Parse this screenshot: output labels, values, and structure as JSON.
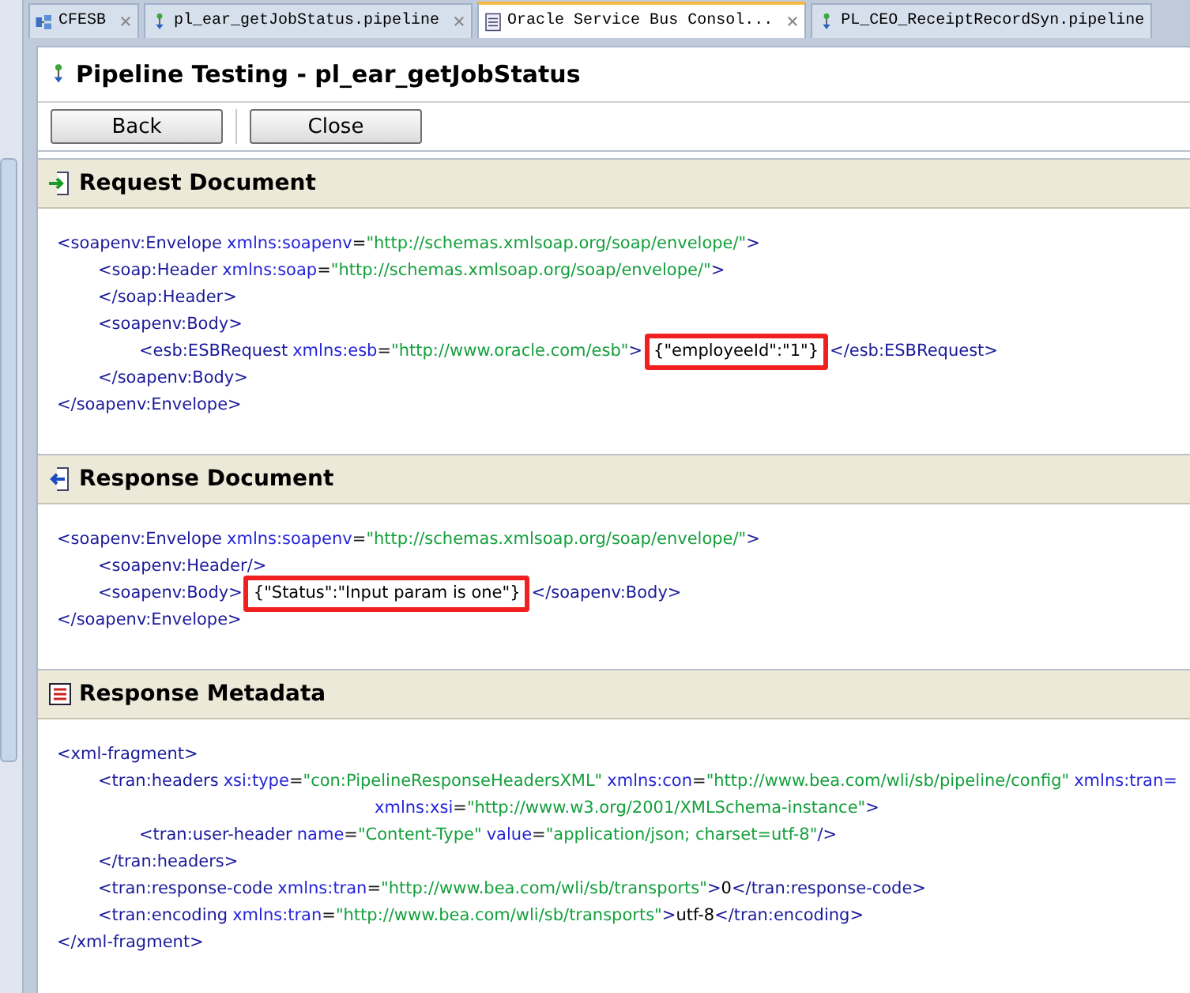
{
  "tabs": [
    {
      "label": "CFESB",
      "selected": false,
      "closable": true
    },
    {
      "label": "pl_ear_getJobStatus.pipeline",
      "selected": false,
      "closable": true
    },
    {
      "label": "Oracle Service Bus Consol...",
      "selected": true,
      "closable": true
    },
    {
      "label": "PL_CEO_ReceiptRecordSyn.pipeline",
      "selected": false,
      "closable": false
    }
  ],
  "page": {
    "title": "Pipeline Testing - pl_ear_getJobStatus",
    "buttons": [
      "Back",
      "Close"
    ]
  },
  "sections": [
    {
      "title": "Request Document",
      "nodes": [
        {
          "tokens": [
            {
              "kind": "tag",
              "text": "<soapenv:Envelope"
            },
            {
              "kind": "attr",
              "text": "xmlns:soapenv"
            },
            {
              "kind": "punct",
              "text": "="
            },
            {
              "kind": "val",
              "text": "\"http://schemas.xmlsoap.org/soap/envelope/\""
            },
            {
              "kind": "tag",
              "text": ">"
            }
          ],
          "children": [
            {
              "tokens": [
                {
                  "kind": "tag",
                  "text": "<soap:Header"
                },
                {
                  "kind": "attr",
                  "text": "xmlns:soap"
                },
                {
                  "kind": "punct",
                  "text": "="
                },
                {
                  "kind": "val",
                  "text": "\"http://schemas.xmlsoap.org/soap/envelope/\""
                },
                {
                  "kind": "tag",
                  "text": ">"
                }
              ]
            },
            {
              "tokens": [
                {
                  "kind": "tag",
                  "text": "</soap:Header>"
                }
              ]
            },
            {
              "tokens": [
                {
                  "kind": "tag",
                  "text": "<soapenv:Body>"
                }
              ],
              "children": [
                {
                  "tokens": [
                    {
                      "kind": "tag",
                      "text": "<esb:ESBRequest"
                    },
                    {
                      "kind": "attr",
                      "text": "xmlns:esb"
                    },
                    {
                      "kind": "punct",
                      "text": "="
                    },
                    {
                      "kind": "val",
                      "text": "\"http://www.oracle.com/esb\""
                    },
                    {
                      "kind": "tag",
                      "text": ">"
                    },
                    {
                      "kind": "text",
                      "text": "{\"employeeId\":\"1\"}",
                      "highlight": true
                    },
                    {
                      "kind": "tag",
                      "text": "</esb:ESBRequest>"
                    }
                  ]
                }
              ]
            },
            {
              "tokens": [
                {
                  "kind": "tag",
                  "text": "</soapenv:Body>"
                }
              ]
            }
          ]
        },
        {
          "tokens": [
            {
              "kind": "tag",
              "text": "</soapenv:Envelope>"
            }
          ]
        }
      ]
    },
    {
      "title": "Response Document",
      "nodes": [
        {
          "tokens": [
            {
              "kind": "tag",
              "text": "<soapenv:Envelope"
            },
            {
              "kind": "attr",
              "text": "xmlns:soapenv"
            },
            {
              "kind": "punct",
              "text": "="
            },
            {
              "kind": "val",
              "text": "\"http://schemas.xmlsoap.org/soap/envelope/\""
            },
            {
              "kind": "tag",
              "text": ">"
            }
          ],
          "children": [
            {
              "tokens": [
                {
                  "kind": "tag",
                  "text": "<soapenv:Header/>"
                }
              ]
            },
            {
              "tokens": [
                {
                  "kind": "tag",
                  "text": "<soapenv:Body>"
                },
                {
                  "kind": "text",
                  "text": "{\"Status\":\"Input param is one\"}",
                  "highlight": true
                },
                {
                  "kind": "tag",
                  "text": "</soapenv:Body>"
                }
              ]
            }
          ]
        },
        {
          "tokens": [
            {
              "kind": "tag",
              "text": "</soapenv:Envelope>"
            }
          ]
        }
      ]
    },
    {
      "title": "Response Metadata",
      "nodes": [
        {
          "tokens": [
            {
              "kind": "tag",
              "text": "<xml-fragment>"
            }
          ],
          "children": [
            {
              "tokens": [
                {
                  "kind": "tag",
                  "text": "<tran:headers"
                },
                {
                  "kind": "attr",
                  "text": "xsi:type"
                },
                {
                  "kind": "punct",
                  "text": "="
                },
                {
                  "kind": "val",
                  "text": "\"con:PipelineResponseHeadersXML\""
                },
                {
                  "kind": "attr",
                  "text": "xmlns:con"
                },
                {
                  "kind": "punct",
                  "text": "="
                },
                {
                  "kind": "val",
                  "text": "\"http://www.bea.com/wli/sb/pipeline/config\""
                },
                {
                  "kind": "attr",
                  "text": "xmlns:tran="
                }
              ],
              "continuation": [
                {
                  "kind": "attr",
                  "text": "xmlns:xsi"
                },
                {
                  "kind": "punct",
                  "text": "="
                },
                {
                  "kind": "val",
                  "text": "\"http://www.w3.org/2001/XMLSchema-instance\""
                },
                {
                  "kind": "tag",
                  "text": ">"
                }
              ],
              "children": [
                {
                  "tokens": [
                    {
                      "kind": "tag",
                      "text": "<tran:user-header"
                    },
                    {
                      "kind": "attr",
                      "text": "name"
                    },
                    {
                      "kind": "punct",
                      "text": "="
                    },
                    {
                      "kind": "val",
                      "text": "\"Content-Type\""
                    },
                    {
                      "kind": "attr",
                      "text": "value"
                    },
                    {
                      "kind": "punct",
                      "text": "="
                    },
                    {
                      "kind": "val",
                      "text": "\"application/json; charset=utf-8\""
                    },
                    {
                      "kind": "tag",
                      "text": "/>"
                    }
                  ]
                }
              ]
            },
            {
              "tokens": [
                {
                  "kind": "tag",
                  "text": "</tran:headers>"
                }
              ]
            },
            {
              "tokens": [
                {
                  "kind": "tag",
                  "text": "<tran:response-code"
                },
                {
                  "kind": "attr",
                  "text": "xmlns:tran"
                },
                {
                  "kind": "punct",
                  "text": "="
                },
                {
                  "kind": "val",
                  "text": "\"http://www.bea.com/wli/sb/transports\""
                },
                {
                  "kind": "tag",
                  "text": ">"
                },
                {
                  "kind": "text",
                  "text": "0"
                },
                {
                  "kind": "tag",
                  "text": "</tran:response-code>"
                }
              ]
            },
            {
              "tokens": [
                {
                  "kind": "tag",
                  "text": "<tran:encoding"
                },
                {
                  "kind": "attr",
                  "text": "xmlns:tran"
                },
                {
                  "kind": "punct",
                  "text": "="
                },
                {
                  "kind": "val",
                  "text": "\"http://www.bea.com/wli/sb/transports\""
                },
                {
                  "kind": "tag",
                  "text": ">"
                },
                {
                  "kind": "text",
                  "text": "utf-8"
                },
                {
                  "kind": "tag",
                  "text": "</tran:encoding>"
                }
              ]
            }
          ]
        },
        {
          "tokens": [
            {
              "kind": "tag",
              "text": "</xml-fragment>"
            }
          ]
        }
      ]
    }
  ]
}
